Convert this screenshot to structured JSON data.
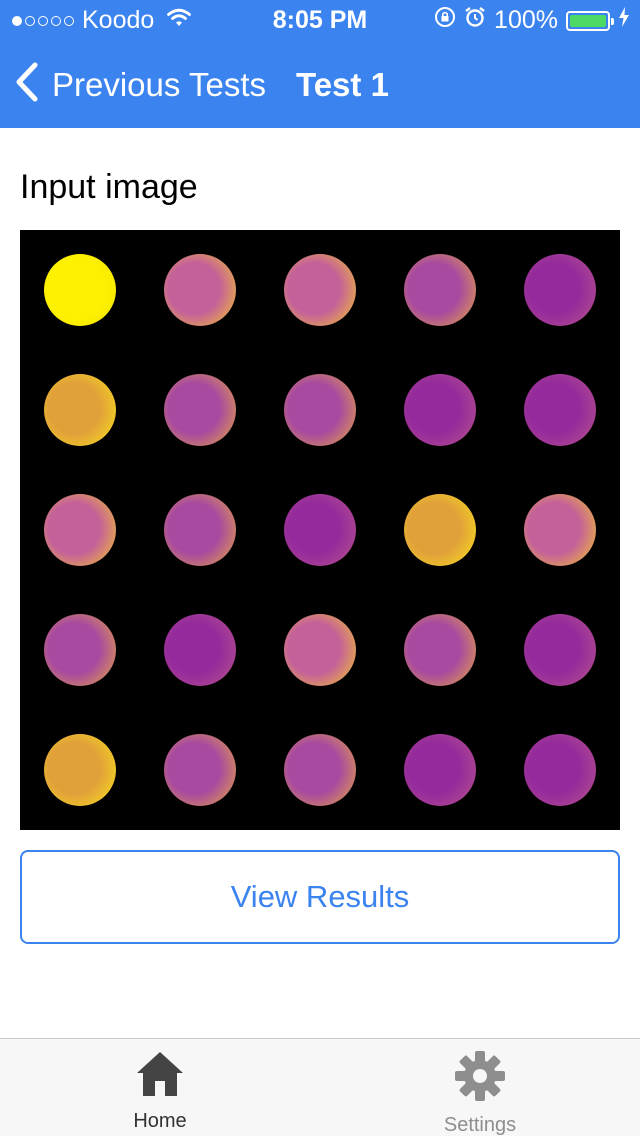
{
  "status_bar": {
    "carrier": "Koodo",
    "time": "8:05 PM",
    "battery_percent": "100%",
    "signal_bars_filled": 1,
    "signal_bars_total": 5,
    "battery_level": 1.0,
    "icons": [
      "wifi-icon",
      "orientation-lock-icon",
      "alarm-icon",
      "battery-icon",
      "charging-icon"
    ]
  },
  "nav": {
    "back_label": "Previous Tests",
    "title": "Test 1",
    "back_icon": "chevron-left-icon"
  },
  "main": {
    "section_title": "Input image",
    "view_results_label": "View Results"
  },
  "input_image": {
    "rows": 5,
    "cols": 5,
    "background": "#000000",
    "dots": [
      [
        "yellow",
        "orange",
        "orange",
        "orange-purple",
        "purple"
      ],
      [
        "yellow-orange",
        "orange-purple",
        "orange-purple",
        "purple",
        "purple"
      ],
      [
        "orange",
        "orange-purple",
        "purple",
        "yellow-orange",
        "orange"
      ],
      [
        "orange-purple",
        "purple",
        "orange",
        "orange-purple",
        "purple"
      ],
      [
        "yellow-orange",
        "orange-purple",
        "orange-purple",
        "purple",
        "purple"
      ]
    ],
    "color_styles": {
      "yellow": {
        "center": "#fff200",
        "edge": "#f5e600"
      },
      "yellow-orange": {
        "center": "#e0a03a",
        "edge": "#fbe21a"
      },
      "orange": {
        "center": "#c4609a",
        "edge": "#f5c928"
      },
      "orange-purple": {
        "center": "#a74aa0",
        "edge": "#eaa83d"
      },
      "purple": {
        "center": "#952a9c",
        "edge": "#b8558a"
      }
    }
  },
  "tab_bar": {
    "tabs": [
      {
        "label": "Home",
        "icon": "house-icon",
        "selected": true
      },
      {
        "label": "Settings",
        "icon": "gear-icon",
        "selected": false
      }
    ],
    "colors": {
      "selected": "#333333",
      "unselected": "#8e8e8e"
    }
  },
  "colors": {
    "accent": "#3b83ee",
    "battery": "#4cd964"
  }
}
